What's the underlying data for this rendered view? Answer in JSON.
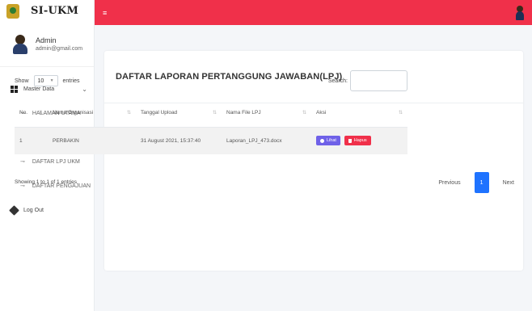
{
  "brand": {
    "title": "SI-UKM",
    "logo_icon": "emblem-logo"
  },
  "user": {
    "name": "Admin",
    "email": "admin@gmail.com"
  },
  "sidebar": {
    "section": {
      "label": "Master Data",
      "icon": "grid-icon"
    },
    "items": [
      {
        "label": "HALAMAN UTAMA"
      },
      {
        "label": "DATA UKM"
      },
      {
        "label": "DAFTAR LPJ UKM"
      },
      {
        "label": "DAFTAR PENGAJUAN"
      }
    ],
    "logout": {
      "label": "Log Out"
    }
  },
  "topbar": {
    "menu_icon": "≡",
    "color": "#f0304a"
  },
  "card": {
    "title": "DAFTAR LAPORAN PERTANGGUNG JAWABAN(LPJ)"
  },
  "controls": {
    "show_label": "Show",
    "entries_value": "10",
    "entries_label": "entries",
    "search_label": "Search:",
    "search_value": ""
  },
  "table": {
    "headers": [
      "No.",
      "Nama Organisasi",
      "Tanggal Upload",
      "Nama File LPJ",
      "Aksi"
    ],
    "rows": [
      {
        "no": "1",
        "organisasi": "PERBAKIN",
        "tanggal": "31 August 2021, 15:37:40",
        "file": "Laporan_LPJ_473.docx",
        "view_label": "Lihat",
        "delete_label": "Hapus"
      }
    ]
  },
  "footer": {
    "info": "Showing 1 to 1 of 1 entries",
    "prev": "Previous",
    "page": "1",
    "next": "Next"
  },
  "colors": {
    "accent": "#f0304a",
    "primary": "#1f73ff",
    "view_button": "#6f61e8"
  }
}
